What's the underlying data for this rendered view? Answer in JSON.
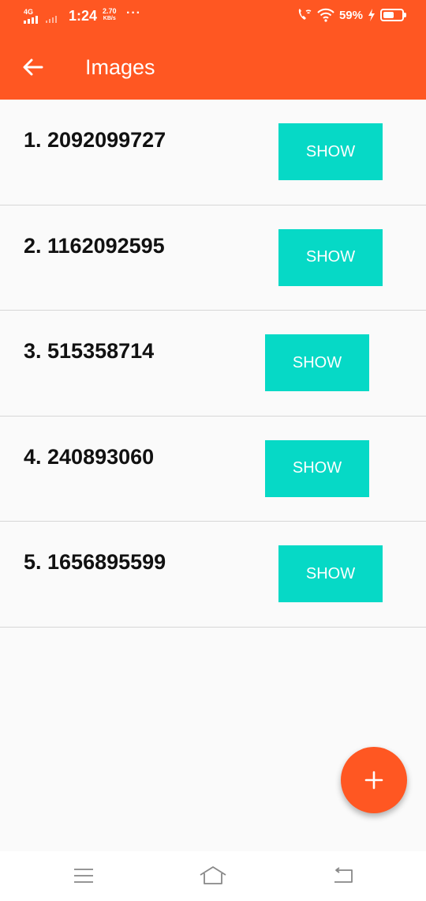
{
  "status_bar": {
    "network": "4G",
    "time": "1:24",
    "speed_value": "2.70",
    "speed_unit": "KB/s",
    "more": "···",
    "battery_percent": "59%",
    "battery_level": 0.59,
    "icons": [
      "signal-icon",
      "wifi-calling-icon",
      "wifi-icon",
      "charging-icon",
      "battery-icon"
    ]
  },
  "app_bar": {
    "title": "Images",
    "back_icon": "arrow-left-icon",
    "color": "#ff5722"
  },
  "items": [
    {
      "label": "1. 2092099727",
      "button": "SHOW"
    },
    {
      "label": "2. 1162092595",
      "button": "SHOW"
    },
    {
      "label": "3. 515358714",
      "button": "SHOW"
    },
    {
      "label": "4. 240893060",
      "button": "SHOW"
    },
    {
      "label": "5. 1656895599",
      "button": "SHOW"
    }
  ],
  "fab": {
    "icon": "plus-icon",
    "color": "#ff5722"
  },
  "button_color": "#06d9c6",
  "nav_bar": {
    "icons": [
      "menu-icon",
      "home-icon",
      "back-icon"
    ]
  }
}
